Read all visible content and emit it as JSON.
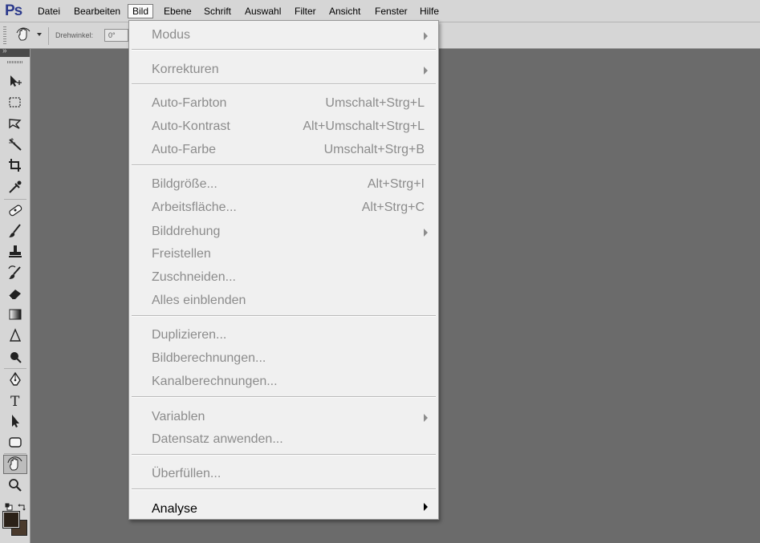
{
  "app": {
    "logo": "Ps"
  },
  "menubar": {
    "items": [
      "Datei",
      "Bearbeiten",
      "Bild",
      "Ebene",
      "Schrift",
      "Auswahl",
      "Filter",
      "Ansicht",
      "Fenster",
      "Hilfe"
    ],
    "active": "Bild"
  },
  "options": {
    "tool_icon": "hand-rotate-icon",
    "rotate_label": "Drehwinkel:",
    "rotate_value": "0°"
  },
  "toolbox": {
    "tools": [
      "move-icon",
      "marquee-icon",
      "lasso-icon",
      "magic-wand-icon",
      "crop-icon",
      "eyedropper-icon",
      "healing-brush-icon",
      "brush-icon",
      "clone-stamp-icon",
      "history-brush-icon",
      "eraser-icon",
      "gradient-icon",
      "blur-icon",
      "dodge-icon",
      "pen-icon",
      "type-icon",
      "path-selection-icon",
      "shape-icon",
      "rotate-view-icon",
      "zoom-icon"
    ],
    "selected": "rotate-view-icon",
    "colors": {
      "foreground": "#2b2118",
      "background": "#4a3a2c"
    }
  },
  "dropdown": {
    "items": [
      {
        "label": "Modus",
        "shortcut": "",
        "submenu": true,
        "enabled": false
      },
      {
        "label": "Korrekturen",
        "shortcut": "",
        "submenu": true,
        "enabled": false
      },
      {
        "label": "Auto-Farbton",
        "shortcut": "Umschalt+Strg+L",
        "submenu": false,
        "enabled": false
      },
      {
        "label": "Auto-Kontrast",
        "shortcut": "Alt+Umschalt+Strg+L",
        "submenu": false,
        "enabled": false
      },
      {
        "label": "Auto-Farbe",
        "shortcut": "Umschalt+Strg+B",
        "submenu": false,
        "enabled": false
      },
      {
        "label": "Bildgröße...",
        "shortcut": "Alt+Strg+I",
        "submenu": false,
        "enabled": false
      },
      {
        "label": "Arbeitsfläche...",
        "shortcut": "Alt+Strg+C",
        "submenu": false,
        "enabled": false
      },
      {
        "label": "Bilddrehung",
        "shortcut": "",
        "submenu": true,
        "enabled": false
      },
      {
        "label": "Freistellen",
        "shortcut": "",
        "submenu": false,
        "enabled": false
      },
      {
        "label": "Zuschneiden...",
        "shortcut": "",
        "submenu": false,
        "enabled": false
      },
      {
        "label": "Alles einblenden",
        "shortcut": "",
        "submenu": false,
        "enabled": false
      },
      {
        "label": "Duplizieren...",
        "shortcut": "",
        "submenu": false,
        "enabled": false
      },
      {
        "label": "Bildberechnungen...",
        "shortcut": "",
        "submenu": false,
        "enabled": false
      },
      {
        "label": "Kanalberechnungen...",
        "shortcut": "",
        "submenu": false,
        "enabled": false
      },
      {
        "label": "Variablen",
        "shortcut": "",
        "submenu": true,
        "enabled": false
      },
      {
        "label": "Datensatz anwenden...",
        "shortcut": "",
        "submenu": false,
        "enabled": false
      },
      {
        "label": "Überfüllen...",
        "shortcut": "",
        "submenu": false,
        "enabled": false
      },
      {
        "label": "Analyse",
        "shortcut": "",
        "submenu": true,
        "enabled": true
      }
    ]
  }
}
